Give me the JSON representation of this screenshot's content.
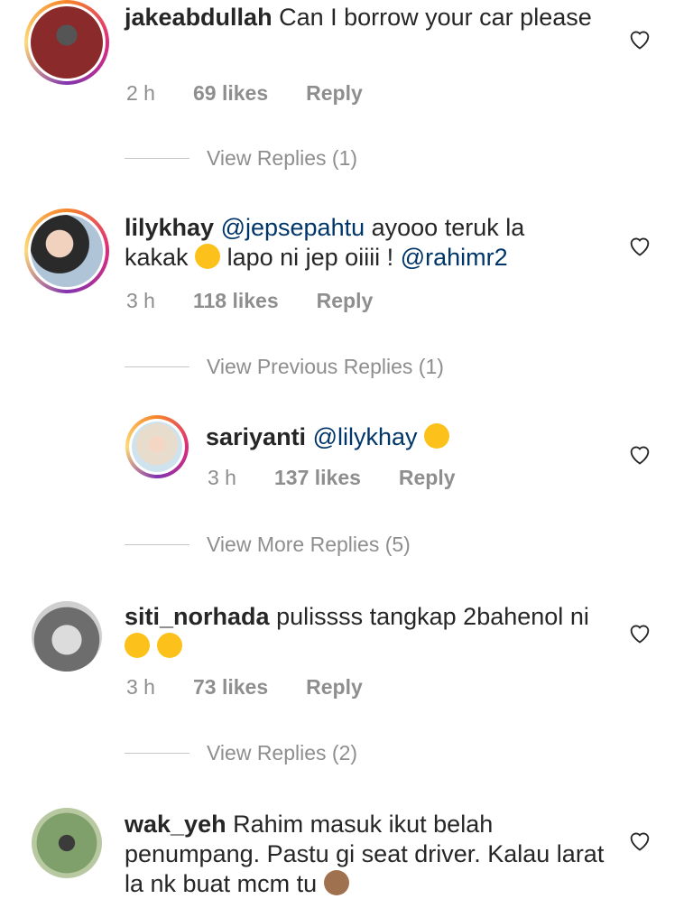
{
  "comments": [
    {
      "user": "jakeabdullah",
      "text": "Can I borrow your car please",
      "time": "2 h",
      "likes": "69 likes",
      "reply": "Reply",
      "replies": "View Replies (1)"
    },
    {
      "user": "lilykhay",
      "mention1": "@jepsepahtu",
      "text_a": "ayooo teruk la kakak",
      "text_b": "lapo ni jep oiiii !",
      "mention2": "@rahimr2",
      "time": "3 h",
      "likes": "118 likes",
      "reply": "Reply",
      "replies": "View Previous Replies (1)"
    },
    {
      "user": "sariyanti",
      "mention1": "@lilykhay",
      "time": "3 h",
      "likes": "137 likes",
      "reply": "Reply",
      "replies": "View More Replies (5)"
    },
    {
      "user": "siti_norhada",
      "text_a": "pulissss tangkap 2bahenol",
      "text_b": "ni",
      "time": "3 h",
      "likes": "73 likes",
      "reply": "Reply",
      "replies": "View Replies (2)"
    },
    {
      "user": "wak_yeh",
      "text": "Rahim masuk ikut belah penumpang. Pastu gi seat driver. Kalau larat la nk buat mcm tu"
    }
  ],
  "colors": {
    "text": "#262626",
    "meta": "#8e8e8e",
    "mention": "#003569",
    "accent": "#dd2a7b"
  },
  "icons": [
    "heart-icon",
    "laugh-emoji-icon",
    "tongue-emoji-icon",
    "monkey-emoji-icon"
  ]
}
